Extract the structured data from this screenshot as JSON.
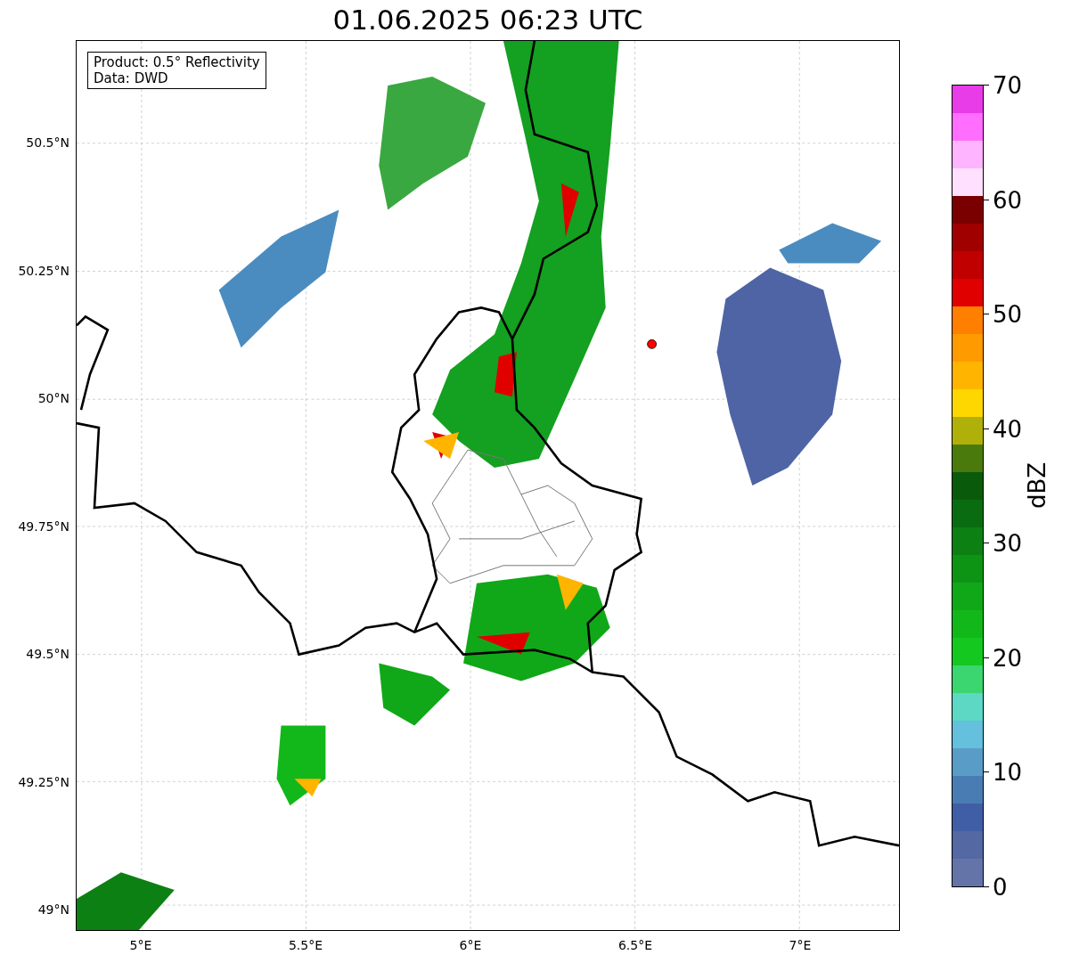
{
  "title": "01.06.2025 06:23 UTC",
  "map": {
    "info_lines": [
      "Product: 0.5° Reflectivity",
      "Data: DWD"
    ],
    "y_ticks": [
      "50.5°N",
      "50.25°N",
      "50°N",
      "49.75°N",
      "49.5°N",
      "49.25°N",
      "49°N"
    ],
    "x_ticks": [
      "5°E",
      "5.5°E",
      "6°E",
      "6.5°E",
      "7°E"
    ]
  },
  "colorbar": {
    "label": "dBZ",
    "ticks": [
      "70",
      "60",
      "50",
      "40",
      "30",
      "20",
      "10",
      "0"
    ],
    "bands": [
      {
        "color": "#e83ce8"
      },
      {
        "color": "#ff6eff"
      },
      {
        "color": "#ffb4ff"
      },
      {
        "color": "#ffe0ff"
      },
      {
        "color": "#7a0000"
      },
      {
        "color": "#a00000"
      },
      {
        "color": "#c00000"
      },
      {
        "color": "#e00000"
      },
      {
        "color": "#ff7f00"
      },
      {
        "color": "#ff9a00"
      },
      {
        "color": "#ffb400"
      },
      {
        "color": "#ffd700"
      },
      {
        "color": "#b0b00a"
      },
      {
        "color": "#4a7a0c"
      },
      {
        "color": "#0a5a0c"
      },
      {
        "color": "#0a6c10"
      },
      {
        "color": "#0c8012"
      },
      {
        "color": "#0e9414"
      },
      {
        "color": "#10a818"
      },
      {
        "color": "#12b81a"
      },
      {
        "color": "#14c820"
      },
      {
        "color": "#3cd670"
      },
      {
        "color": "#5cd8c4"
      },
      {
        "color": "#64c0dc"
      },
      {
        "color": "#5a9cc8"
      },
      {
        "color": "#4a7cb4"
      },
      {
        "color": "#405ea6"
      },
      {
        "color": "#5468a4"
      },
      {
        "color": "#6474a8"
      }
    ]
  }
}
